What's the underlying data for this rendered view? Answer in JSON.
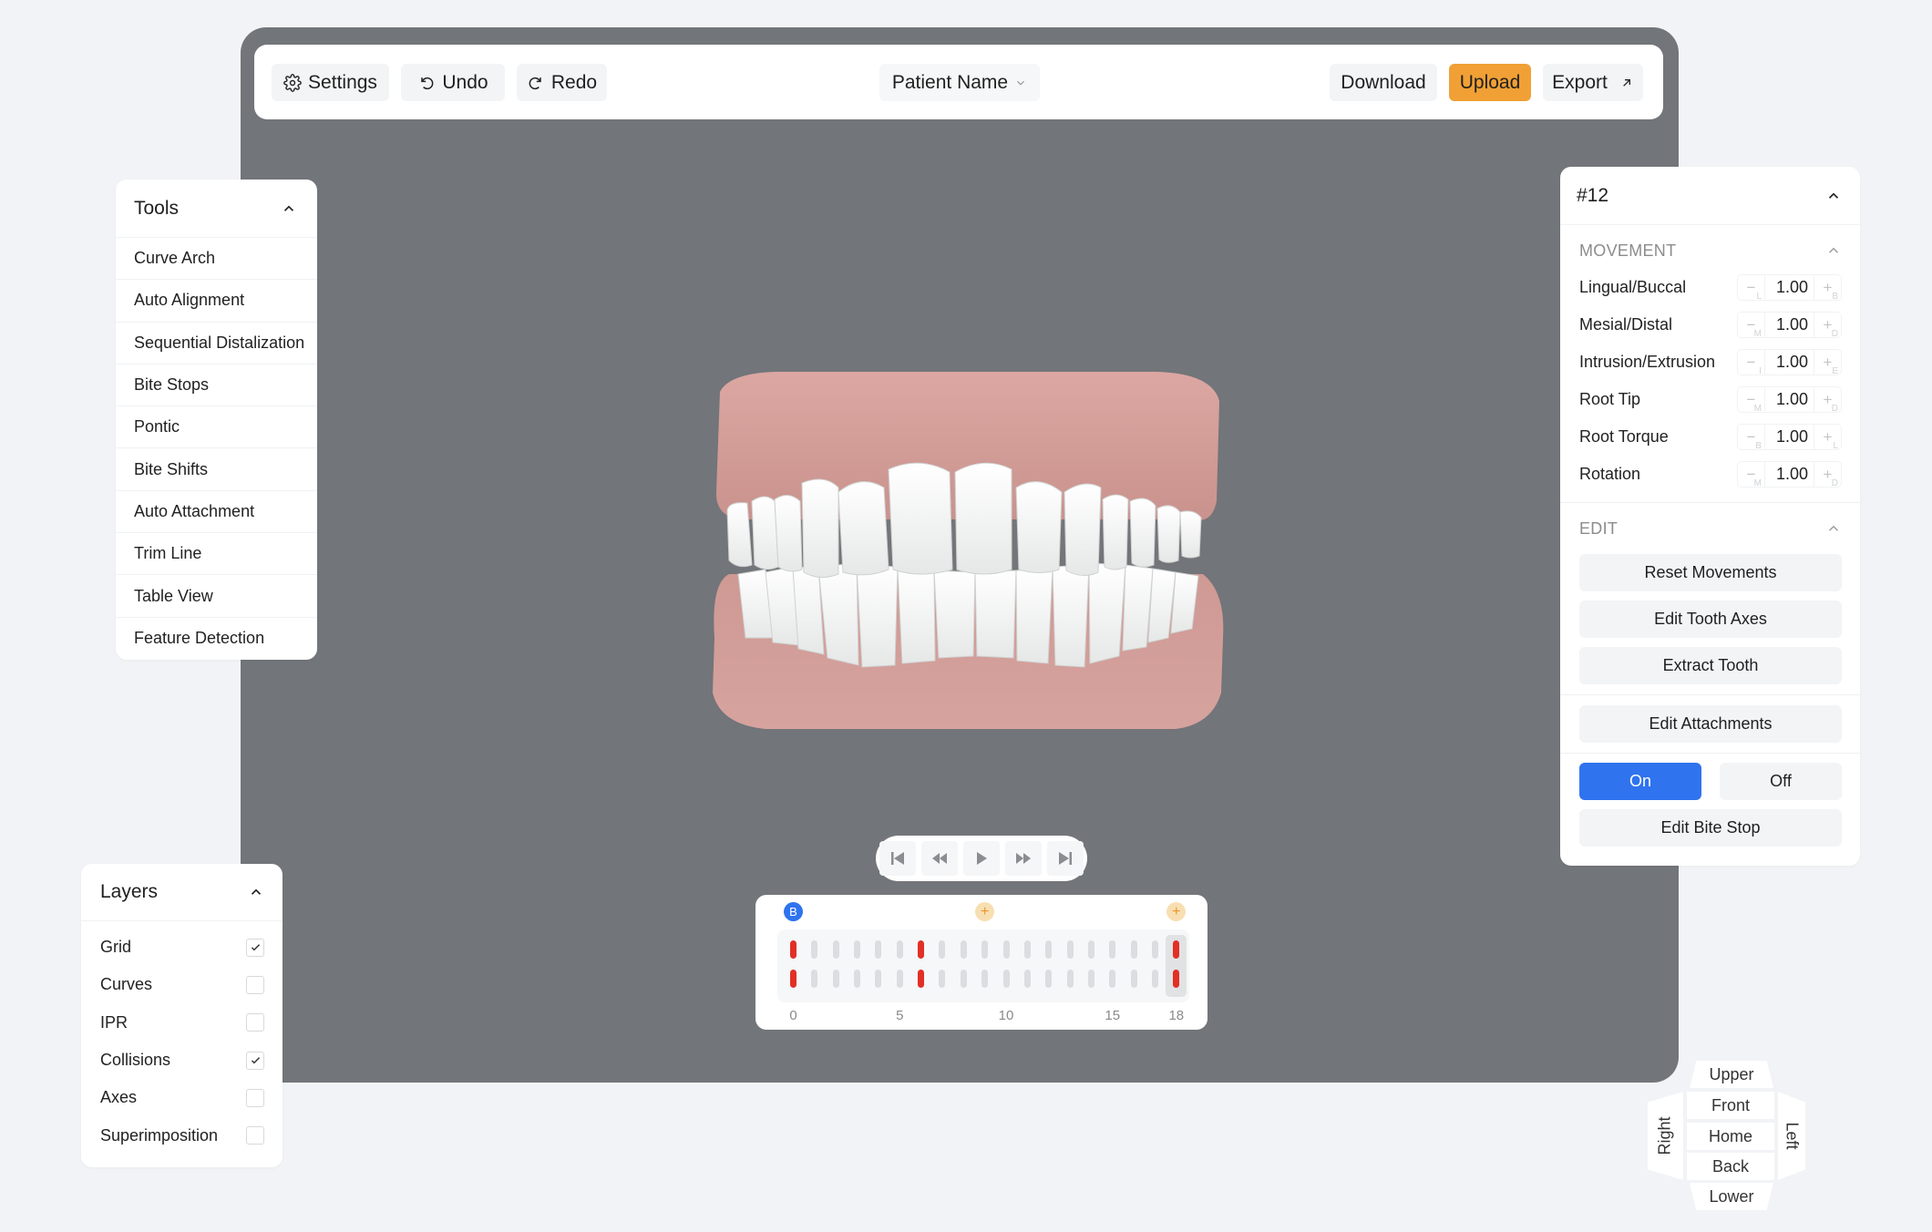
{
  "toolbar": {
    "settings_label": "Settings",
    "undo_label": "Undo",
    "redo_label": "Redo",
    "patient_label": "Patient Name",
    "download_label": "Download",
    "upload_label": "Upload",
    "export_label": "Export"
  },
  "colors": {
    "accent": "#2f73ee",
    "upload": "#f0a035",
    "collision": "#e13025",
    "viewport": "#727579",
    "gum": "#d4a09c",
    "tooth": "#f4f5f4"
  },
  "tools": {
    "title": "Tools",
    "items": [
      {
        "label": "Curve Arch"
      },
      {
        "label": "Auto Alignment"
      },
      {
        "label": "Sequential Distalization"
      },
      {
        "label": "Bite Stops"
      },
      {
        "label": "Pontic"
      },
      {
        "label": "Bite Shifts"
      },
      {
        "label": "Auto Attachment"
      },
      {
        "label": "Trim Line"
      },
      {
        "label": "Table View"
      },
      {
        "label": "Feature Detection"
      }
    ]
  },
  "layers": {
    "title": "Layers",
    "items": [
      {
        "label": "Grid",
        "checked": true
      },
      {
        "label": "Curves",
        "checked": false
      },
      {
        "label": "IPR",
        "checked": false
      },
      {
        "label": "Collisions",
        "checked": true
      },
      {
        "label": "Axes",
        "checked": false
      },
      {
        "label": "Superimposition",
        "checked": false
      }
    ]
  },
  "tooth_panel": {
    "title": "#12",
    "movement": {
      "title": "MOVEMENT",
      "rows": [
        {
          "label": "Lingual/Buccal",
          "value": "1.00",
          "minus_sub": "L",
          "plus_sub": "B"
        },
        {
          "label": "Mesial/Distal",
          "value": "1.00",
          "minus_sub": "M",
          "plus_sub": "D"
        },
        {
          "label": "Intrusion/Extrusion",
          "value": "1.00",
          "minus_sub": "I",
          "plus_sub": "E"
        },
        {
          "label": "Root Tip",
          "value": "1.00",
          "minus_sub": "M",
          "plus_sub": "D"
        },
        {
          "label": "Root Torque",
          "value": "1.00",
          "minus_sub": "B",
          "plus_sub": "L"
        },
        {
          "label": "Rotation",
          "value": "1.00",
          "minus_sub": "M",
          "plus_sub": "D"
        }
      ]
    },
    "edit": {
      "title": "EDIT",
      "reset_movements": "Reset Movements",
      "edit_tooth_axes": "Edit Tooth Axes",
      "extract_tooth": "Extract Tooth",
      "edit_attachments": "Edit Attachments",
      "on_label": "On",
      "off_label": "Off",
      "bite_stop_state": "On",
      "edit_bite_stop": "Edit Bite Stop"
    }
  },
  "player": {
    "buttons": [
      "skip-to-start",
      "rewind",
      "play",
      "fast-forward",
      "skip-to-end"
    ]
  },
  "timeline": {
    "base_marker": "B",
    "add_marker": "+",
    "add_marker_steps": [
      9,
      18
    ],
    "step_count": 19,
    "current_step": 18,
    "collision_steps": [
      0,
      6,
      18
    ],
    "tick_labels": [
      {
        "step": 0,
        "label": "0"
      },
      {
        "step": 5,
        "label": "5"
      },
      {
        "step": 10,
        "label": "10"
      },
      {
        "step": 15,
        "label": "15"
      },
      {
        "step": 18,
        "label": "18"
      }
    ]
  },
  "view_cube": {
    "upper": "Upper",
    "front": "Front",
    "home": "Home",
    "back": "Back",
    "lower": "Lower",
    "right": "Right",
    "left": "Left"
  }
}
